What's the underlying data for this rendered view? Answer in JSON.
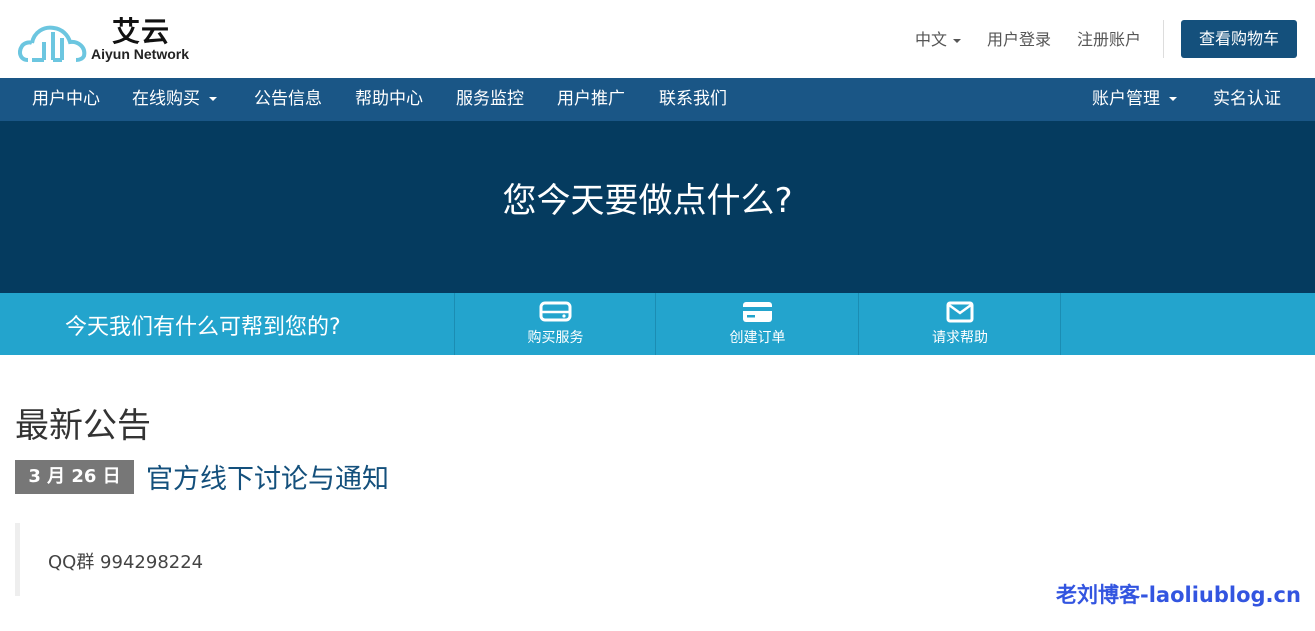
{
  "brand": {
    "name_cn": "艾云",
    "name_en": "Aiyun Network",
    "logo_color": "#6cc6e0"
  },
  "header": {
    "language": "中文",
    "login": "用户登录",
    "register": "注册账户",
    "cart_button": "查看购物车"
  },
  "nav": {
    "items": [
      "用户中心",
      "在线购买",
      "公告信息",
      "帮助中心",
      "服务监控",
      "用户推广",
      "联系我们"
    ],
    "right_items": [
      "账户管理",
      "实名认证"
    ]
  },
  "hero": {
    "title": "您今天要做点什么?"
  },
  "help_bar": {
    "text": "今天我们有什么可帮到您的?",
    "actions": [
      {
        "label": "购买服务",
        "icon": "server-icon"
      },
      {
        "label": "创建订单",
        "icon": "credit-card-icon"
      },
      {
        "label": "请求帮助",
        "icon": "envelope-icon"
      }
    ]
  },
  "announcements": {
    "section_title": "最新公告",
    "items": [
      {
        "date": "3 月 26 日",
        "title": "官方线下讨论与通知",
        "body": "QQ群 994298224"
      }
    ]
  },
  "watermark": "老刘博客-laoliublog.cn",
  "colors": {
    "nav_bg": "#1a5686",
    "hero_bg": "#053b5f",
    "help_bg": "#23a4cd",
    "primary": "#14507c",
    "badge_bg": "#777777"
  }
}
